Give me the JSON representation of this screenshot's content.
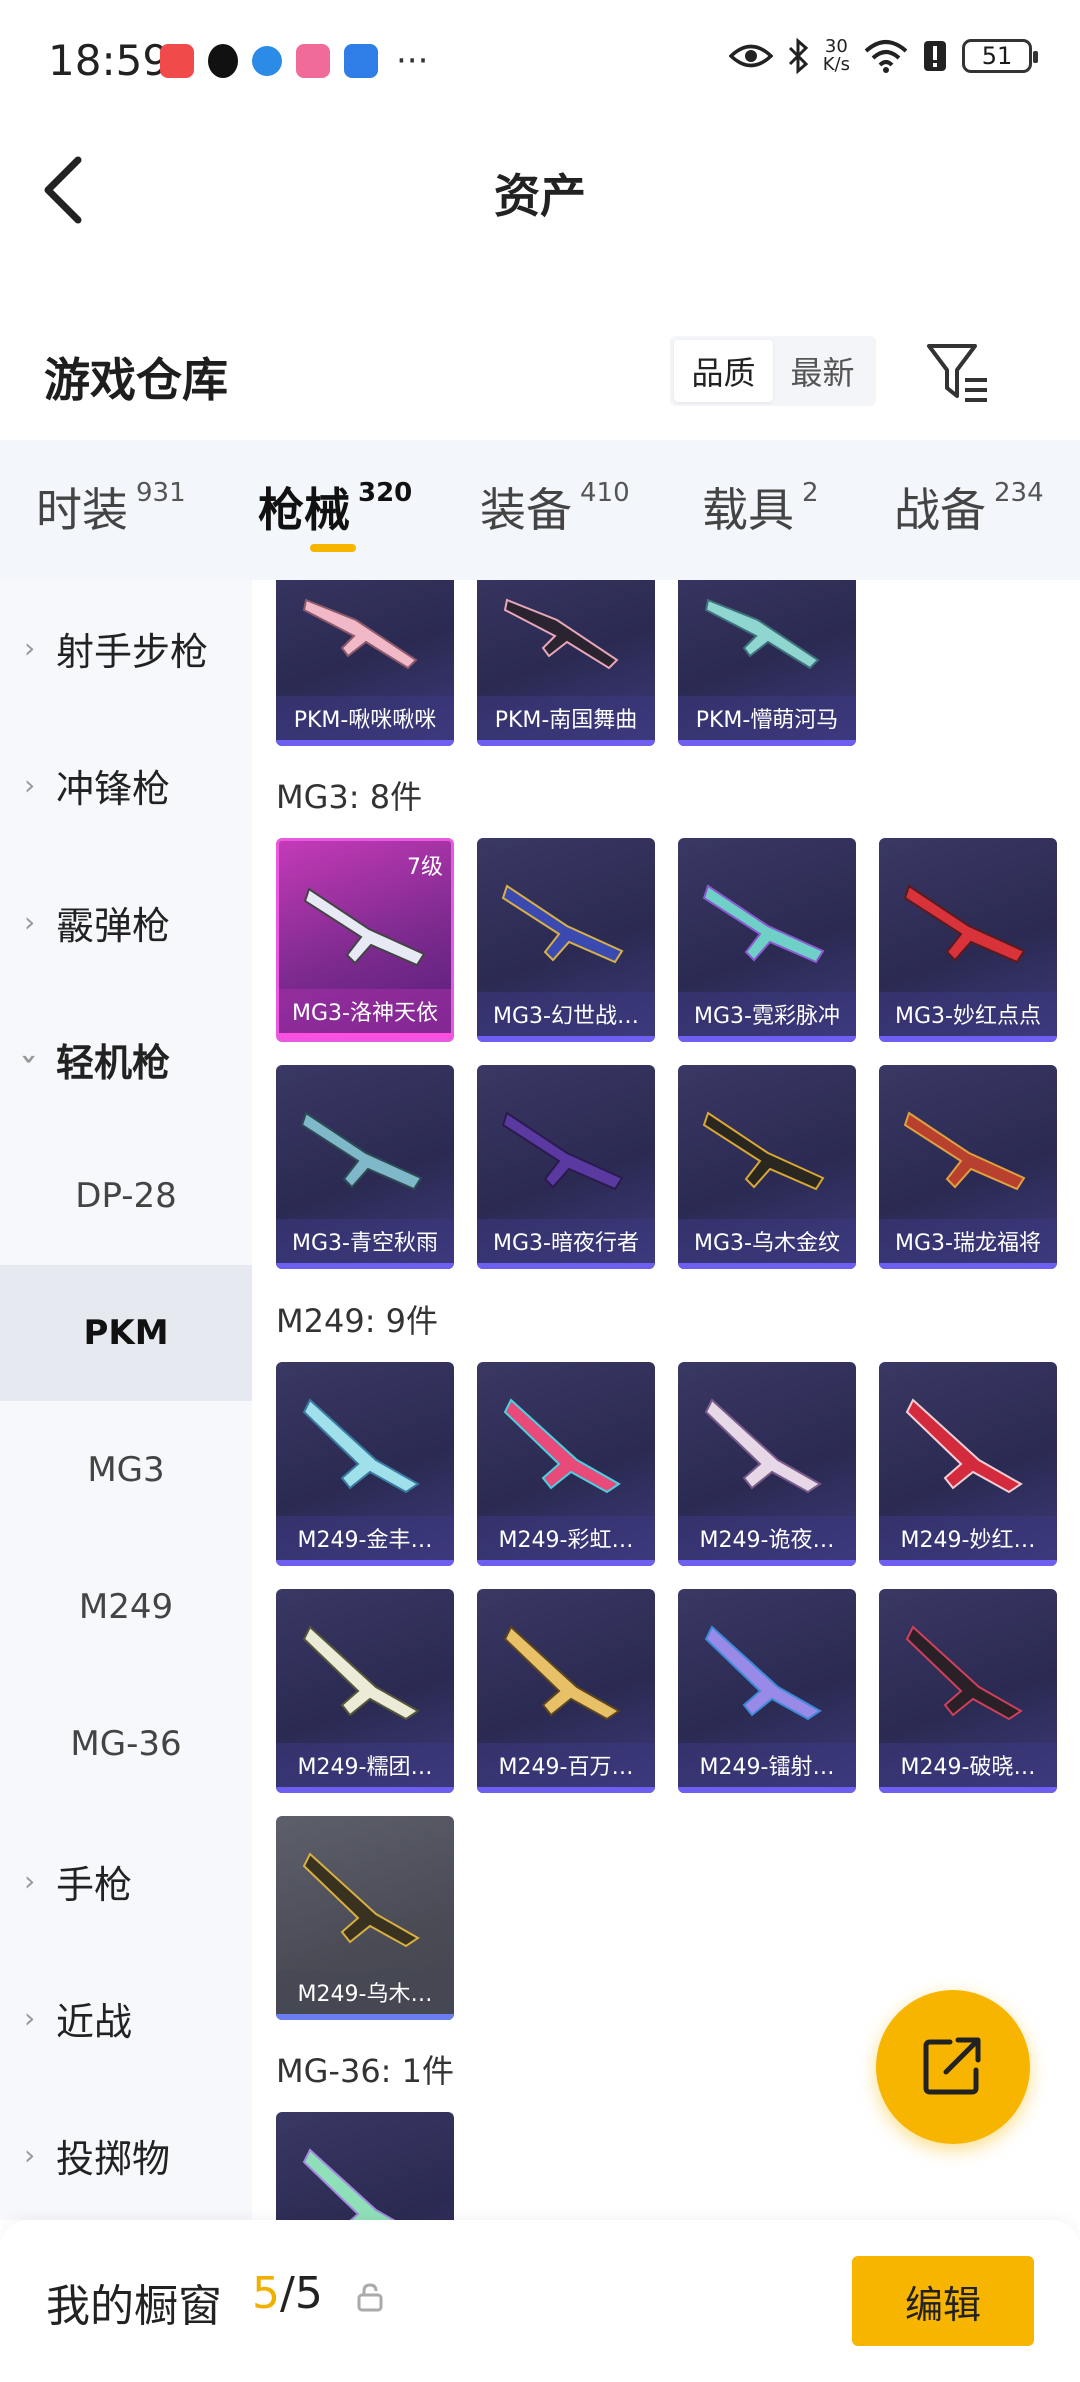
{
  "status_bar": {
    "time": "18:59",
    "net_speed_value": "30",
    "net_speed_unit": "K/s",
    "battery": "51",
    "more": "···"
  },
  "header": {
    "title": "资产"
  },
  "section": {
    "title": "游戏仓库",
    "sort_options": [
      "品质",
      "最新"
    ],
    "active_sort": "品质"
  },
  "tabs": [
    {
      "label": "时装",
      "count": "931"
    },
    {
      "label": "枪械",
      "count": "320"
    },
    {
      "label": "装备",
      "count": "410"
    },
    {
      "label": "载具",
      "count": "2"
    },
    {
      "label": "战备",
      "count": "234"
    }
  ],
  "sidebar": {
    "items": [
      {
        "label": "射手步枪",
        "type": "category"
      },
      {
        "label": "冲锋枪",
        "type": "category"
      },
      {
        "label": "霰弹枪",
        "type": "category"
      },
      {
        "label": "轻机枪",
        "type": "category",
        "expanded": true
      },
      {
        "label": "DP-28",
        "type": "sub"
      },
      {
        "label": "PKM",
        "type": "sub",
        "active": true
      },
      {
        "label": "MG3",
        "type": "sub"
      },
      {
        "label": "M249",
        "type": "sub"
      },
      {
        "label": "MG-36",
        "type": "sub"
      },
      {
        "label": "手枪",
        "type": "category"
      },
      {
        "label": "近战",
        "type": "category"
      },
      {
        "label": "投掷物",
        "type": "category"
      }
    ]
  },
  "groups": [
    {
      "title": "",
      "items": [
        "PKM-啾咪啾咪",
        "PKM-南国舞曲",
        "PKM-懵萌河马"
      ]
    },
    {
      "title": "MG3: 8件",
      "items": [
        "MG3-洛神天依",
        "MG3-幻世战…",
        "MG3-霓彩脉冲",
        "MG3-妙红点点",
        "MG3-青空秋雨",
        "MG3-暗夜行者",
        "MG3-乌木金纹",
        "MG3-瑞龙福将"
      ],
      "level_badge": "7级"
    },
    {
      "title": "M249: 9件",
      "items": [
        "M249-金丰…",
        "M249-彩虹…",
        "M249-诡夜…",
        "M249-妙红…",
        "M249-糯团…",
        "M249-百万…",
        "M249-镭射…",
        "M249-破晓…",
        "M249-乌木…"
      ]
    },
    {
      "title": "MG-36: 1件",
      "items": [
        ""
      ]
    }
  ],
  "bottom_bar": {
    "label": "我的橱窗",
    "current": "5",
    "separator": "/",
    "max": "5",
    "edit_label": "编辑"
  },
  "colors": {
    "accent": "#f7b500",
    "card_bg": "#2f2e5a",
    "rare_card": "#b43ab0"
  }
}
